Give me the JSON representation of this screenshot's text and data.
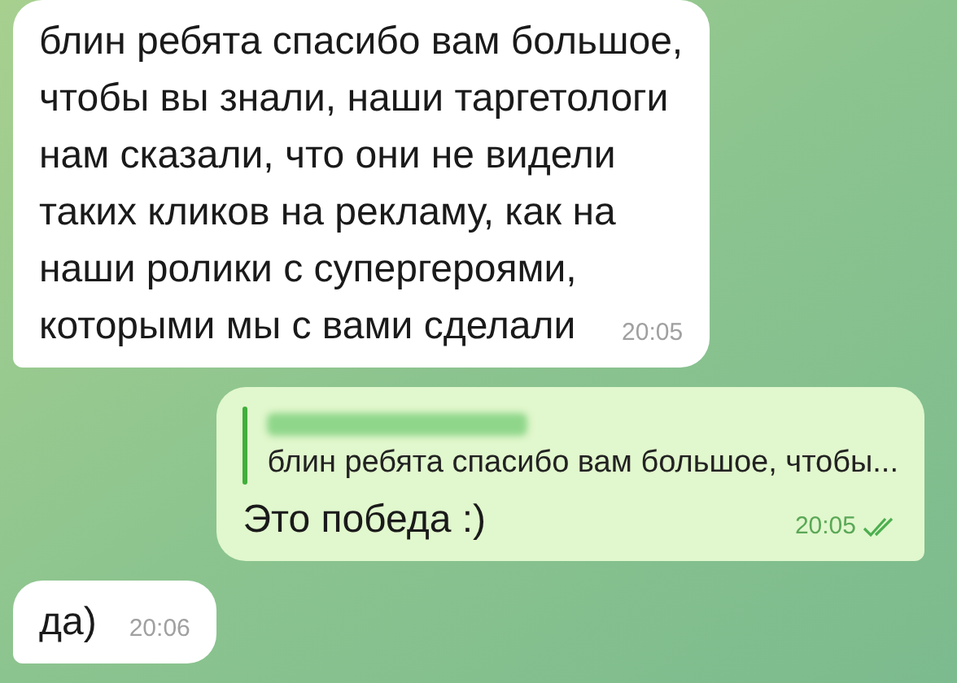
{
  "messages": [
    {
      "kind": "incoming",
      "lines": [
        "блин ребята спасибо вам большое,",
        "чтобы вы знали, наши таргетологи",
        "нам сказали, что они не видели",
        "таких кликов на рекламу, как на",
        "наши ролики с супергероями,",
        "которыми мы с вами сделали"
      ],
      "time": "20:05"
    },
    {
      "kind": "outgoing",
      "reply": {
        "text": "блин ребята спасибо вам большое, чтобы..."
      },
      "lines": [
        "Это победа :)"
      ],
      "time": "20:05",
      "read": true
    },
    {
      "kind": "incoming",
      "lines": [
        "да)"
      ],
      "time": "20:06"
    }
  ]
}
